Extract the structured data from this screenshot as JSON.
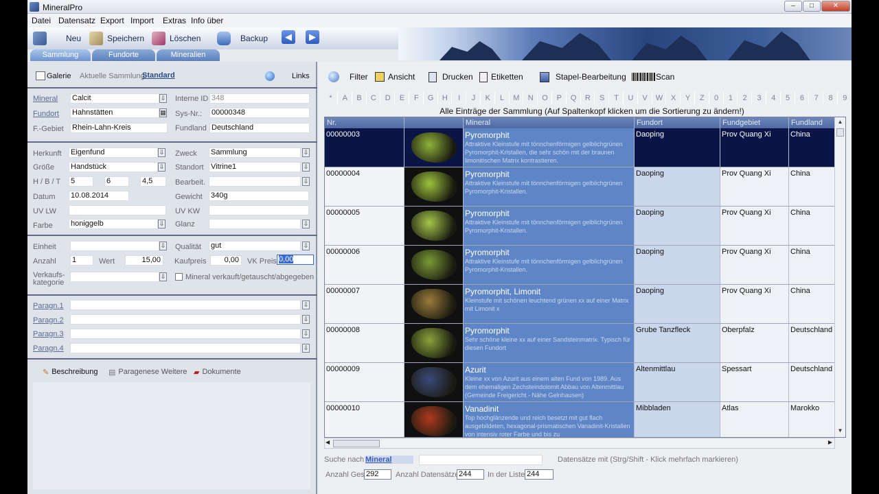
{
  "window": {
    "title": "MineralPro"
  },
  "menu": [
    "Datei",
    "Datensatz",
    "Export",
    "Import",
    "Extras",
    "Info über"
  ],
  "toolbar": {
    "new": "Neu",
    "save": "Speichern",
    "delete": "Löschen",
    "backup": "Backup"
  },
  "tabs": [
    "Sammlung",
    "Fundorte",
    "Mineralien"
  ],
  "left": {
    "galerie": "Galerie",
    "aktuelle_label": "Aktuelle Sammlung:",
    "aktuelle_value": "Standard",
    "links": "Links",
    "mineral_label": "Mineral",
    "mineral": "Calcit",
    "interne_id_label": "Interne ID",
    "interne_id": "348",
    "fundort_label": "Fundort",
    "fundort": "Hahnstätten",
    "sysnr_label": "Sys-Nr.:",
    "sysnr": "00000348",
    "fgebiet_label": "F.-Gebiet",
    "fgebiet": "Rhein-Lahn-Kreis",
    "fundland_label": "Fundland",
    "fundland": "Deutschland",
    "herkunft_label": "Herkunft",
    "herkunft": "Eigenfund",
    "zweck_label": "Zweck",
    "zweck": "Sammlung",
    "groesse_label": "Größe",
    "groesse": "Handstück",
    "standort_label": "Standort",
    "standort": "Vitrine1",
    "hbt_label": "H / B / T",
    "h": "5",
    "b": "6",
    "t": "4,5",
    "bearbeit_label": "Bearbeit.",
    "datum_label": "Datum",
    "datum": "10.08.2014",
    "gewicht_label": "Gewicht",
    "gewicht": "340g",
    "uvlw_label": "UV LW",
    "uvkw_label": "UV KW",
    "farbe_label": "Farbe",
    "farbe": "honiggelb",
    "glanz_label": "Glanz",
    "einheit_label": "Einheit",
    "qualitaet_label": "Qualität",
    "qualitaet": "gut",
    "anzahl_label": "Anzahl",
    "anzahl": "1",
    "wert_label": "Wert",
    "wert": "15,00",
    "kaufpreis_label": "Kaufpreis",
    "kaufpreis": "0,00",
    "vkpreis_label": "VK Preis",
    "vkpreis": "0,00",
    "verkaufs_label1": "Verkaufs-",
    "verkaufs_label2": "kategorie",
    "verkauft_label": "Mineral verkauft/getauscht/abgegeben",
    "paragn": [
      "Paragn.1",
      "Paragn.2",
      "Paragn.3",
      "Paragn.4"
    ],
    "subtabs": [
      "Beschreibung",
      "Paragenese Weitere",
      "Dokumente"
    ]
  },
  "right": {
    "toolbar": {
      "filter": "Filter",
      "ansicht": "Ansicht",
      "drucken": "Drucken",
      "etiketten": "Etiketten",
      "stapel": "Stapel-Bearbeitung",
      "scan": "Scan"
    },
    "alphabet": [
      "*",
      "A",
      "B",
      "C",
      "D",
      "E",
      "F",
      "G",
      "H",
      "I",
      "J",
      "K",
      "L",
      "M",
      "N",
      "O",
      "P",
      "Q",
      "R",
      "S",
      "T",
      "U",
      "V",
      "W",
      "X",
      "Y",
      "Z",
      "0",
      "1",
      "2",
      "3",
      "4",
      "5",
      "6",
      "7",
      "8",
      "9"
    ],
    "header_msg": "Alle Einträge der Sammlung (Auf Spaltenkopf klicken um die Sortierung zu ändern!)",
    "columns": [
      "Nr.",
      "",
      "Mineral",
      "Fundort",
      "Fundgebiet",
      "Fundland"
    ],
    "rows": [
      {
        "nr": "00000003",
        "mineral": "Pyromorphit",
        "desc": "Attraktive Kleinstufe mit tönnchenförmigen gelblichgrünen Pyromorphit-Kristallen, die sehr schön mit der braunen limonitischen Matrix kontrastieren.",
        "fundort": "Daoping",
        "fundgebiet": "Prov Quang Xi",
        "fundland": "China",
        "color": "#8fb23a"
      },
      {
        "nr": "00000004",
        "mineral": "Pyromorphit",
        "desc": "Attraktive Kleinstufe mit tönnchenförmigen gelblichgrünen Pyromorphit-Kristallen.",
        "fundort": "Daoping",
        "fundgebiet": "Prov Quang Xi",
        "fundland": "China",
        "color": "#9cc23c"
      },
      {
        "nr": "00000005",
        "mineral": "Pyromorphit",
        "desc": "Attraktive Kleinstufe mit tönnchenförmigen gelblichgrünen Pyromorphit-Kristallen.",
        "fundort": "Daoping",
        "fundgebiet": "Prov Quang Xi",
        "fundland": "China",
        "color": "#a4c64a"
      },
      {
        "nr": "00000006",
        "mineral": "Pyromorphit",
        "desc": "Attraktive Kleinstufe mit tönnchenförmigen gelblichgrünen Pyromorphit-Kristallen.",
        "fundort": "Daoping",
        "fundgebiet": "Prov Quang Xi",
        "fundland": "China",
        "color": "#7a9a34"
      },
      {
        "nr": "00000007",
        "mineral": "Pyromorphit, Limonit",
        "desc": "Kleinstufe mit schönen leuchtend grünen xx auf einer Matrix mit Limonit x",
        "fundort": "Daoping",
        "fundgebiet": "Prov Quang Xi",
        "fundland": "China",
        "color": "#9a7a3a"
      },
      {
        "nr": "00000008",
        "mineral": "Pyromorphit",
        "desc": "Sehr schöne kleine xx auf einer Sandsteinmatrix. Typisch für diesen Fundort",
        "fundort": "Grube Tanzfleck",
        "fundgebiet": "Oberpfalz",
        "fundland": "Deutschland",
        "color": "#8aa23a"
      },
      {
        "nr": "00000009",
        "mineral": "Azurit",
        "desc": "Kleine xx von Azurit aus einem alten Fund von 1989. Aus dem ehemaligen Zechsteindolomit Abbau von Altenmittlau (Gemeinde Freigericht - Nähe Gelnhausen)",
        "fundort": "Altenmittlau",
        "fundgebiet": "Spessart",
        "fundland": "Deutschland",
        "color": "#3a4a7a"
      },
      {
        "nr": "00000010",
        "mineral": "Vanadinit",
        "desc": "Top hochglänzende und reich besetzt mit gut flach ausgebildeten, hexagonal-prismatischen Vanadinit-Kristallen von intensiv roter Farbe und bis zu",
        "fundort": "Mibbladen",
        "fundgebiet": "Atlas",
        "fundland": "Marokko",
        "color": "#b03a1e"
      }
    ],
    "footer": {
      "suche_label": "Suche nach",
      "suche_value": "Mineral",
      "datensaetze_msg": "Datensätze mit (Strg/Shift - Klick mehrfach markieren)",
      "anzahl_ges_label": "Anzahl Ges.",
      "anzahl_ges": "292",
      "anzahl_ds_label": "Anzahl Datensätze",
      "anzahl_ds": "244",
      "liste_label": "In der Liste",
      "liste": "244"
    }
  }
}
